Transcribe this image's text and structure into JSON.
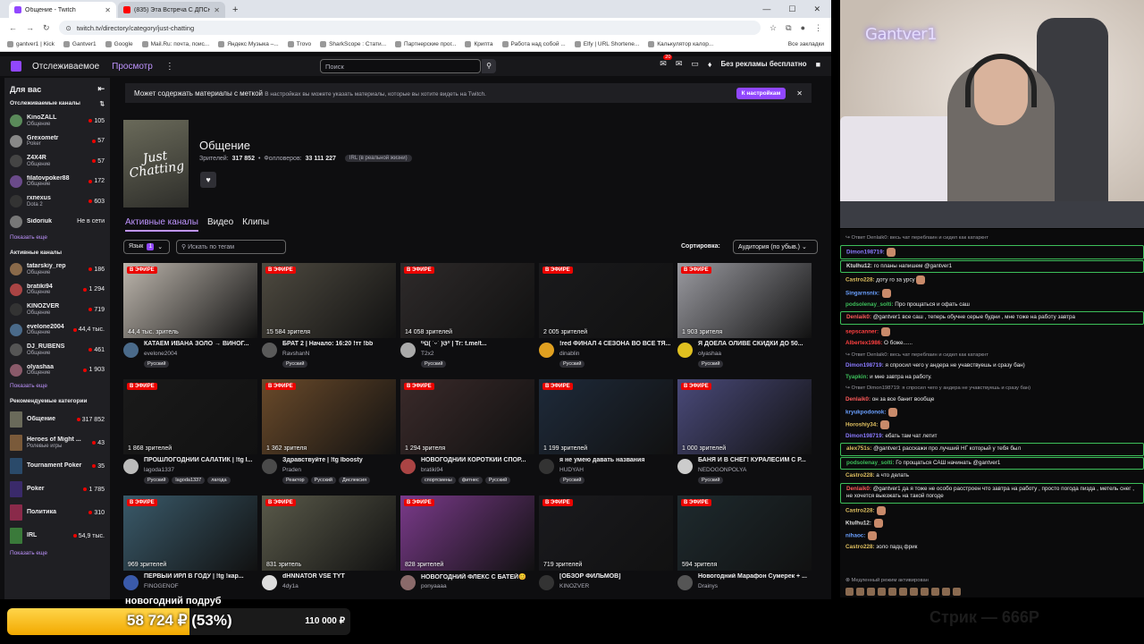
{
  "browser": {
    "tabs": [
      {
        "label": "Общение - Twitch",
        "active": true,
        "icon_color": "#9147ff"
      },
      {
        "label": "(835) Эта Встреча С ДПСнико...",
        "active": false,
        "icon_color": "#ff0000"
      }
    ],
    "new_tab": "+",
    "window_controls": {
      "minimize": "—",
      "maximize": "☐",
      "close": "✕"
    },
    "url": "twitch.tv/directory/category/just-chatting",
    "bookmarks": [
      "gantver1 | Kick",
      "Gantver1",
      "Google",
      "Mail.Ru: почта, поис...",
      "Яндекс Музыка –...",
      "Trovo",
      "SharkScope : Стати...",
      "Партнерские прог...",
      "Крипта",
      "Работа над собой ...",
      "Elfy | URL Shortene...",
      "Калькулятор калор..."
    ],
    "all_bookmarks": "Все закладки"
  },
  "header": {
    "following": "Отслеживаемое",
    "browse": "Просмотр",
    "search_placeholder": "Поиск",
    "notif_count": "20",
    "no_ads": "Без рекламы бесплатно"
  },
  "sidebar": {
    "title": "Для вас",
    "followed_title": "Отслеживаемые каналы",
    "followed": [
      {
        "name": "KinoZALL",
        "game": "Общение",
        "count": "105",
        "color": "#5a8a5a"
      },
      {
        "name": "Grexometr",
        "game": "Poker",
        "count": "57",
        "color": "#888"
      },
      {
        "name": "Z4X4R",
        "game": "Общение",
        "count": "57",
        "color": "#444"
      },
      {
        "name": "filatovpoker88",
        "game": "Общение",
        "count": "172",
        "color": "#6a4a8a"
      },
      {
        "name": "rxnexus",
        "game": "Dota 2",
        "count": "603",
        "color": "#333"
      },
      {
        "name": "Sidoriuk",
        "game": "",
        "count": "Не в сети",
        "color": "#777"
      }
    ],
    "show_more": "Показать еще",
    "active_title": "Активные каналы",
    "active": [
      {
        "name": "tatarskiy_rep",
        "game": "Общение",
        "count": "186",
        "color": "#8a6a4a"
      },
      {
        "name": "bratiki94",
        "game": "Общение",
        "count": "1 294",
        "color": "#aa4444"
      },
      {
        "name": "KINOZVER",
        "game": "Общение",
        "count": "719",
        "color": "#333"
      },
      {
        "name": "evelone2004",
        "game": "Общение",
        "count": "44,4 тыс.",
        "color": "#4a6a8a"
      },
      {
        "name": "DJ_RUBENS",
        "game": "Общение",
        "count": "461",
        "color": "#555"
      },
      {
        "name": "olyashaa",
        "game": "Общение",
        "count": "1 903",
        "color": "#8a5a6a"
      }
    ],
    "show_more2": "Показать еще",
    "rec_title": "Рекомендуемые категории",
    "categories": [
      {
        "name": "Общение",
        "sub": "",
        "count": "317 852",
        "color": "#6a6a5a"
      },
      {
        "name": "Heroes of Might ...",
        "sub": "Ролевые игры",
        "count": "43",
        "color": "#7a5a3a"
      },
      {
        "name": "Tournament Poker",
        "sub": "",
        "count": "35",
        "color": "#2a4a6a"
      },
      {
        "name": "Poker",
        "sub": "",
        "count": "1 785",
        "color": "#3a2a6a"
      },
      {
        "name": "Политика",
        "sub": "",
        "count": "310",
        "color": "#8a2a4a"
      },
      {
        "name": "IRL",
        "sub": "",
        "count": "54,9 тыс.",
        "color": "#3a7a3a"
      }
    ],
    "show_more3": "Показать еще"
  },
  "banner": {
    "text": "Может содержать материалы с меткой",
    "sub": "В настройках вы можете указать материалы, которые вы хотите видеть на Twitch.",
    "button": "К настройкам",
    "close": "✕"
  },
  "category": {
    "title": "Общение",
    "box_text": "Just Chatting",
    "viewers_label": "Зрителей:",
    "viewers": "317 852",
    "followers_label": "Фолловеров:",
    "followers": "33 111 227",
    "tag": "IRL (в реальной жизни)"
  },
  "tabs": [
    "Активные каналы",
    "Видео",
    "Клипы"
  ],
  "filters": {
    "language": "Язык",
    "language_count": "1",
    "tag_placeholder": "Искать по тегам",
    "sort_label": "Сортировка:",
    "sort_value": "Аудитория (по убыв.)"
  },
  "live_label": "В ЭФИРЕ",
  "streams": [
    {
      "viewers": "44,4 тыс. зритель",
      "title": "КАТАЕМ ИВАНА ЗОЛО → ВИНОГ...",
      "channel": "evelone2004",
      "tags": [
        "Русский"
      ],
      "bg": "#bdb6ad",
      "av": "#4a6a8a"
    },
    {
      "viewers": "15 584 зрителя",
      "title": "БРАТ 2 | Начало: 16:20 !тт !bb",
      "channel": "RavshanN",
      "tags": [
        "Русский"
      ],
      "bg": "#4e4a40",
      "av": "#5a5a5a"
    },
    {
      "viewers": "14 058 зрителей",
      "title": "⁽⁽ଘ( ˊᵕˋ )ଓ⁾⁾ | Tr: t.me/t...",
      "channel": "T2x2",
      "tags": [
        "Русский"
      ],
      "bg": "#2e2a2a",
      "av": "#aaa"
    },
    {
      "viewers": "2 005 зрителей",
      "title": "!red ФИНАЛ 4 СЕЗОНА ВО ВСЕ ТЯ...",
      "channel": "dinablin",
      "tags": [
        "Русский"
      ],
      "bg": "#1a1a1c",
      "av": "#e0a020"
    },
    {
      "viewers": "1 903 зрителя",
      "title": "Я ДОЕЛА ОЛИВЕ СКИДКИ ДО 50...",
      "channel": "olyashaa",
      "tags": [
        "Русский"
      ],
      "bg": "#9a9aa0",
      "av": "#e0c020"
    },
    {
      "viewers": "1 868 зрителей",
      "title": "ПРОШЛОГОДНИЙ САЛАТИК | !tg I...",
      "channel": "lagoda1337",
      "tags": [
        "Русский",
        "lagoda1337",
        "лагода"
      ],
      "bg": "#1a1a1a",
      "av": "#bbb"
    },
    {
      "viewers": "1 362 зрителя",
      "title": "Здравствуйте | !tg lboosty",
      "channel": "Praden",
      "tags": [
        "Реактор",
        "Русский",
        "Дислексия"
      ],
      "bg": "#6a4a2a",
      "av": "#4a4a4a"
    },
    {
      "viewers": "1 294 зрителя",
      "title": "НОВОГОДНИЙ КОРОТКИЙ СПОР...",
      "channel": "bratiki94",
      "tags": [
        "спортсмены",
        "фитнес",
        "Русский"
      ],
      "bg": "#3a2a2a",
      "av": "#aa4444"
    },
    {
      "viewers": "1 199 зрителей",
      "title": "я не умею давать названия",
      "channel": "HUDYAH",
      "tags": [
        "Русский"
      ],
      "bg": "#1e2a3a",
      "av": "#333"
    },
    {
      "viewers": "1 000 зрителей",
      "title": "БАНЯ И В СНЕГ! КУРАЛЕСИМ С Р...",
      "channel": "NEDOGONPOLYA",
      "tags": [
        "Русский"
      ],
      "bg": "#4a4a7a",
      "av": "#ccc"
    },
    {
      "viewers": "969 зрителей",
      "title": "ПЕРВЫЙ ИРЛ В ГОДУ | !tg !кар...",
      "channel": "FINOGENOF",
      "tags": [],
      "bg": "#3a5a6a",
      "av": "#3a5aaa"
    },
    {
      "viewers": "831 зритель",
      "title": "dHNNATOR VSE TYT",
      "channel": "4dy1a",
      "tags": [],
      "bg": "#5a5a4a",
      "av": "#ddd"
    },
    {
      "viewers": "828 зрителей",
      "title": "НОВОГОДНИЙ ФЛЕКС С БАТЕЙ😊",
      "channel": "ponyaaaa",
      "tags": [],
      "bg": "#7a3a8a",
      "av": "#8a6a6a"
    },
    {
      "viewers": "719 зрителей",
      "title": "[ОБЗОР ФИЛЬМОВ]",
      "channel": "KINOZVER",
      "tags": [],
      "bg": "#1a1a1e",
      "av": "#333"
    },
    {
      "viewers": "594 зрителя",
      "title": "Новогодний Марафон Сумерек + ...",
      "channel": "Drainys",
      "tags": [],
      "bg": "#1e2a2e",
      "av": "#555"
    }
  ],
  "cam": {
    "name": "Gantver1"
  },
  "chat": [
    {
      "reply": true,
      "text": "↪ Ответ Denlaik0: весь чат переблаин и сидел как катаркнт"
    },
    {
      "user": "Dimon198719:",
      "uc": "#8a7aff",
      "text": " ",
      "emo": true,
      "hl": true
    },
    {
      "user": "Ktulhu12:",
      "uc": "#e0e0e0",
      "text": " го планы напишем @gantver1",
      "hl": true
    },
    {
      "user": "Castro228:",
      "uc": "#e0c060",
      "text": " доту го за урсу",
      "emo": true
    },
    {
      "user": "Singarnsnix:",
      "uc": "#6aa0ff",
      "text": " ",
      "emo": true
    },
    {
      "user": "podsolenay_solti:",
      "uc": "#3dbf5a",
      "text": " Про прощаться и офать саш"
    },
    {
      "user": "Denlaik0:",
      "uc": "#ff5a5a",
      "text": " @gantver1 все саш , теперь обучне серые будни , мне тоже на работу завтра",
      "hl": true
    },
    {
      "user": "sepscanner:",
      "uc": "#ff4040",
      "text": " ",
      "emo": true
    },
    {
      "user": "Albertex1986:",
      "uc": "#ff4040",
      "text": " О боже......"
    },
    {
      "reply": true,
      "text": "↪ Ответ Denlaik0: весь чат переблаин и сидел как катаркнт"
    },
    {
      "user": "Dimon198719:",
      "uc": "#8a7aff",
      "text": " я спросил чего у андера не учавствуешь и сразу бан)"
    },
    {
      "user": "Tyapkin:",
      "uc": "#3dbf5a",
      "text": " и мне завтра на работу."
    },
    {
      "reply": true,
      "text": "↪ Ответ Dimon198719: я спросил чего у андера не учавствуешь и сразу бан)"
    },
    {
      "user": "Denlaik0:",
      "uc": "#ff5a5a",
      "text": " он за все банит вообще"
    },
    {
      "user": "kryukpodonok:",
      "uc": "#6aa0ff",
      "text": " ",
      "emo": true
    },
    {
      "user": "Horoshiy34:",
      "uc": "#e0c060",
      "text": " ",
      "emo": true
    },
    {
      "user": "Dimon198719:",
      "uc": "#8a7aff",
      "text": " ебать там чат летит"
    },
    {
      "user": "alex751s:",
      "uc": "#e0c060",
      "text": " @gantver1 расскажи про лучший НГ который у тебя был",
      "hl": true
    },
    {
      "user": "podsolenay_solti:",
      "uc": "#3dbf5a",
      "text": " Го прощаться САШ начинать @gantver1",
      "hl": true
    },
    {
      "user": "Castro228:",
      "uc": "#e0c060",
      "text": " а что делать"
    },
    {
      "user": "Denlaik0:",
      "uc": "#ff5a5a",
      "text": " @gantver1 да я тоже не особо расстроен что завтра на работу , просто погода пизда , метель снег , не хочется выезжать на такой погоде",
      "hl": true
    },
    {
      "user": "Castro228:",
      "uc": "#e0c060",
      "text": " ",
      "emo": true
    },
    {
      "user": "Ktulhu12:",
      "uc": "#e0e0e0",
      "text": " ",
      "emo": true
    },
    {
      "user": "nihaoc:",
      "uc": "#6aa0ff",
      "text": " ",
      "emo": true
    },
    {
      "user": "Castro228:",
      "uc": "#e0c060",
      "text": " золо падц фрик"
    }
  ],
  "chat_status": "⊗ Медленный режим активирован",
  "donation": {
    "title": "новогодний подруб",
    "value": "58 724 ₽ (53%)",
    "fraction": 0.53,
    "goal": "110 000 ₽",
    "fill_color": "#f2a900"
  },
  "watermark": "Стрик — 666Р"
}
